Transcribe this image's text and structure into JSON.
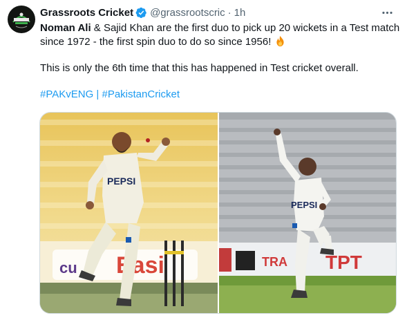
{
  "account": {
    "display_name": "Grassroots Cricket",
    "handle": "@grassrootscric",
    "separator": "·",
    "time": "1h",
    "avatar_icon": "grassroots-cricket-logo",
    "verified_icon": "verified-badge-icon",
    "verified_color": "#1d9bf0"
  },
  "tweet": {
    "line1_bold": "Noman Ali",
    "line1_rest": " & Sajid Khan are the first duo to pick up 20 wickets in a Test match since 1972 - the first spin duo to do so since 1956! ",
    "line1_emoji": "fire-emoji",
    "line2": "This is only the 6th time that this has happened in Test cricket overall.",
    "hashtag1": "#PAKvENG",
    "hashtag_separator": " | ",
    "hashtag2": "#PakistanCricket",
    "link_color": "#1d9bf0"
  },
  "media": {
    "photo1": {
      "subject": "cricket-bowler-sajid-khan",
      "shirt_sponsor": "PEPSI",
      "board_text": "Easi",
      "board_text_2": "cu"
    },
    "photo2": {
      "subject": "cricket-bowler-noman-ali",
      "shirt_sponsor": "PEPSI",
      "board_text": "TPT",
      "board_text_2": "TRA"
    }
  },
  "more_icon": "more-horizontal-icon"
}
